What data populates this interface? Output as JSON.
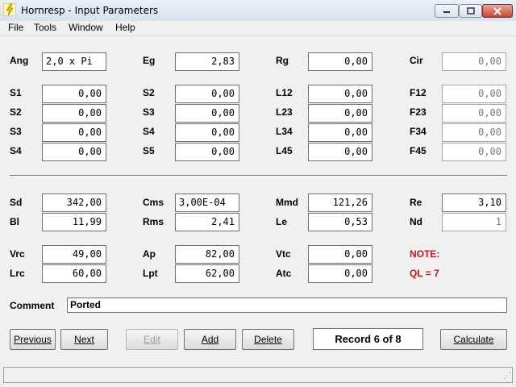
{
  "window": {
    "title": "Hornresp - Input Parameters"
  },
  "menu": [
    "File",
    "Tools",
    "Window",
    "Help"
  ],
  "params_top": [
    {
      "label": "Ang",
      "value": "2,0 x Pi"
    },
    {
      "label": "Eg",
      "value": "2,83"
    },
    {
      "label": "Rg",
      "value": "0,00"
    },
    {
      "label": "Cir",
      "value": "0,00"
    }
  ],
  "horn_rows": [
    {
      "col1": {
        "label": "S1",
        "value": "0,00"
      },
      "col2": {
        "label": "S2",
        "value": "0,00"
      },
      "col3": {
        "label": "L12",
        "value": "0,00"
      },
      "col4": {
        "label": "F12",
        "value": "0,00"
      }
    },
    {
      "col1": {
        "label": "S2",
        "value": "0,00"
      },
      "col2": {
        "label": "S3",
        "value": "0,00"
      },
      "col3": {
        "label": "L23",
        "value": "0,00"
      },
      "col4": {
        "label": "F23",
        "value": "0,00"
      }
    },
    {
      "col1": {
        "label": "S3",
        "value": "0,00"
      },
      "col2": {
        "label": "S4",
        "value": "0,00"
      },
      "col3": {
        "label": "L34",
        "value": "0,00"
      },
      "col4": {
        "label": "F34",
        "value": "0,00"
      }
    },
    {
      "col1": {
        "label": "S4",
        "value": "0,00"
      },
      "col2": {
        "label": "S5",
        "value": "0,00"
      },
      "col3": {
        "label": "L45",
        "value": "0,00"
      },
      "col4": {
        "label": "F45",
        "value": "0,00"
      }
    }
  ],
  "driver": {
    "Sd": "342,00",
    "Bl": "11,99",
    "Cms": "3,00E-04",
    "Rms": "2,41",
    "Mmd": "121,26",
    "Le": "0,53",
    "Re": "3,10",
    "Nd": "1"
  },
  "chamber": {
    "Vrc": "49,00",
    "Lrc": "60,00",
    "Ap": "82,00",
    "Lpt": "62,00",
    "Vtc": "0,00",
    "Atc": "0,00"
  },
  "note": {
    "title": "NOTE:",
    "text": "QL = 7"
  },
  "comment": {
    "label": "Comment",
    "value": "Ported"
  },
  "buttons": {
    "previous": "Previous",
    "next": "Next",
    "edit": "Edit",
    "add": "Add",
    "delete": "Delete",
    "calculate": "Calculate"
  },
  "record": "Record 6 of 8",
  "colors": {
    "note": "#d21414",
    "disabled_text": "#7a7a7a"
  }
}
